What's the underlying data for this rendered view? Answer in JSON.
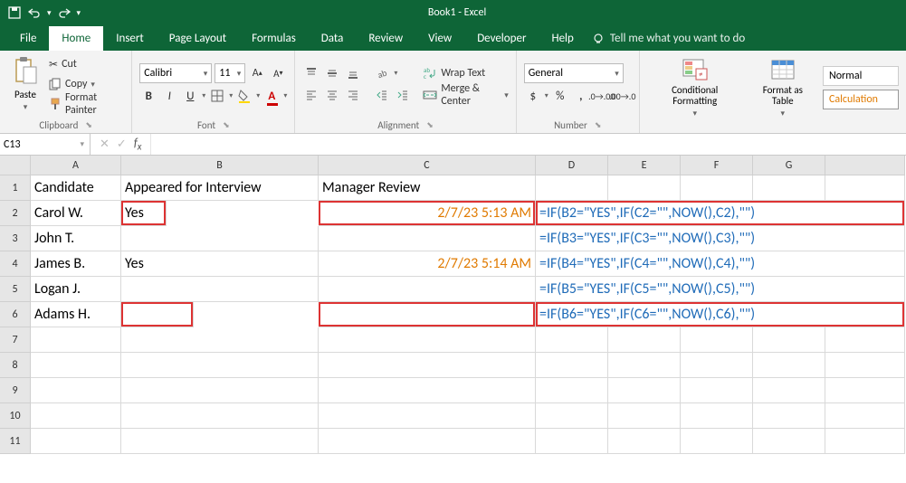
{
  "title": "Book1 - Excel",
  "qat": {
    "save": "save-icon",
    "undo": "undo-icon",
    "redo": "redo-icon"
  },
  "tabs": [
    "File",
    "Home",
    "Insert",
    "Page Layout",
    "Formulas",
    "Data",
    "Review",
    "View",
    "Developer",
    "Help"
  ],
  "active_tab": "Home",
  "tellme": "Tell me what you want to do",
  "clipboard": {
    "paste": "Paste",
    "cut": "Cut",
    "copy": "Copy",
    "fmtpainter": "Format Painter",
    "label": "Clipboard"
  },
  "font": {
    "name": "Calibri",
    "size": "11",
    "label": "Font",
    "bold": "B",
    "italic": "I",
    "underline": "U"
  },
  "alignment": {
    "wrap": "Wrap Text",
    "merge": "Merge & Center",
    "label": "Alignment"
  },
  "number": {
    "format": "General",
    "label": "Number"
  },
  "styles": {
    "cond": "Conditional Formatting",
    "fmt_table": "Format as Table",
    "normal": "Normal",
    "calc": "Calculation"
  },
  "namebox": "C13",
  "fx": "",
  "columns": [
    "A",
    "B",
    "C",
    "D",
    "E",
    "F",
    "G"
  ],
  "rows": [
    "1",
    "2",
    "3",
    "4",
    "5",
    "6",
    "7",
    "8",
    "9",
    "10",
    "11"
  ],
  "data": {
    "A1": "Candidate",
    "B1": "Appeared for Interview",
    "C1": "Manager Review",
    "A2": "Carol W.",
    "B2": "Yes",
    "C2": "2/7/23 5:13 AM",
    "D2": "=IF(B2=\"YES\",IF(C2=\"\",NOW(),C2),\"\")",
    "A3": "John T.",
    "D3": "=IF(B3=\"YES\",IF(C3=\"\",NOW(),C3),\"\")",
    "A4": "James B.",
    "B4": "Yes",
    "C4": "2/7/23 5:14 AM",
    "D4": "=IF(B4=\"YES\",IF(C4=\"\",NOW(),C4),\"\")",
    "A5": "Logan J.",
    "D5": "=IF(B5=\"YES\",IF(C5=\"\",NOW(),C5),\"\")",
    "A6": "Adams H.",
    "D6": "=IF(B6=\"YES\",IF(C6=\"\",NOW(),C6),\"\")"
  }
}
